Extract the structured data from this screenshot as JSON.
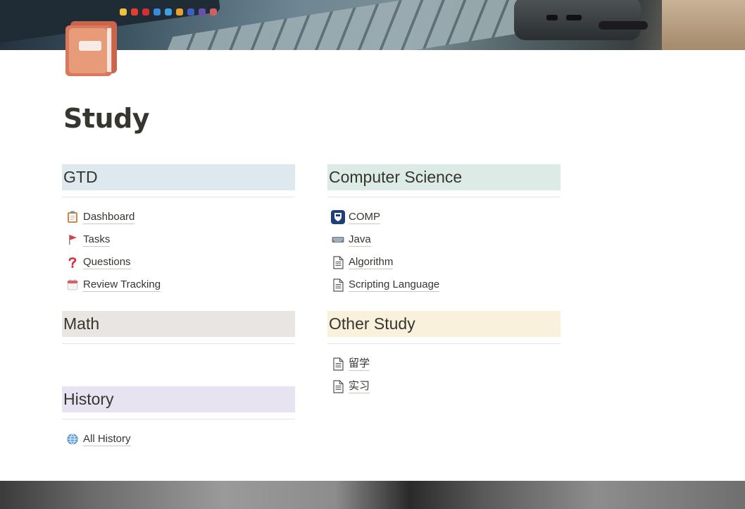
{
  "page": {
    "title": "Study",
    "icon": "notebook-icon"
  },
  "colors": {
    "gtd_header": "#dde9ee",
    "cs_header": "#ddebe6",
    "math_header": "#e9e5e3",
    "other_header": "#faf1dc",
    "history_header": "#e8e3f0"
  },
  "sections": {
    "gtd": {
      "title": "GTD",
      "items": [
        {
          "label": "Dashboard",
          "icon": "clipboard-icon"
        },
        {
          "label": "Tasks",
          "icon": "red-flag-icon"
        },
        {
          "label": "Questions",
          "icon": "question-mark-icon"
        },
        {
          "label": "Review Tracking",
          "icon": "calendar-icon"
        }
      ]
    },
    "cs": {
      "title": "Computer Science",
      "items": [
        {
          "label": "COMP",
          "icon": "shield-icon"
        },
        {
          "label": "Java",
          "icon": "keyboard-icon"
        },
        {
          "label": "Algorithm",
          "icon": "page-icon"
        },
        {
          "label": "Scripting Language",
          "icon": "page-icon"
        }
      ]
    },
    "math": {
      "title": "Math",
      "items": []
    },
    "other": {
      "title": "Other Study",
      "items": [
        {
          "label": "留学",
          "icon": "page-icon"
        },
        {
          "label": "实习",
          "icon": "page-icon"
        }
      ]
    },
    "history": {
      "title": "History",
      "items": [
        {
          "label": "All History",
          "icon": "globe-icon"
        }
      ]
    }
  }
}
